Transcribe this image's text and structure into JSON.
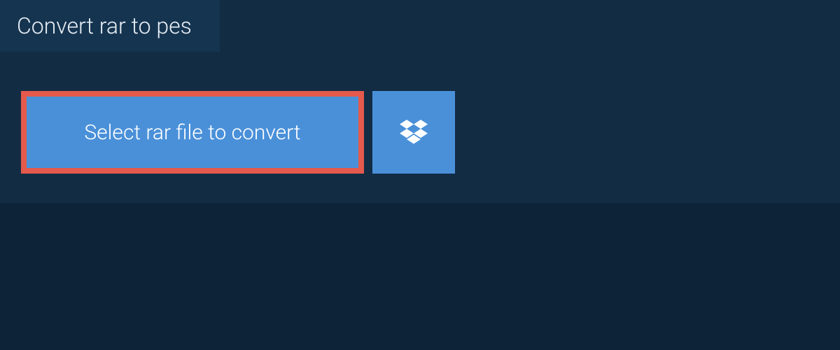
{
  "tab": {
    "title": "Convert rar to pes"
  },
  "buttons": {
    "select_file_label": "Select rar file to convert"
  }
}
